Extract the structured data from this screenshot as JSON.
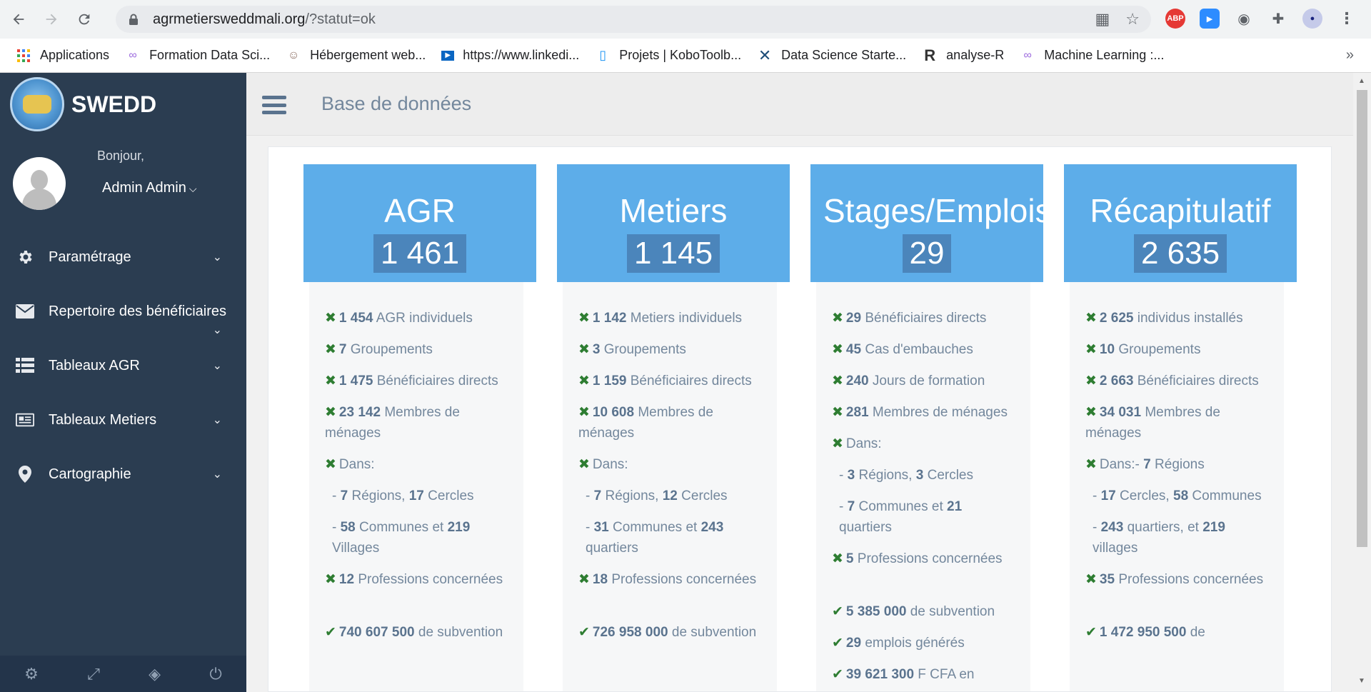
{
  "browser": {
    "url_host": "agrmetiersweddmali.org",
    "url_path": "/?statut=ok",
    "bookmarks": [
      {
        "label": "Applications",
        "icon": "apps-grid-icon"
      },
      {
        "label": "Formation Data Sci...",
        "icon": "infinity-icon"
      },
      {
        "label": "Hébergement web...",
        "icon": "mascot-icon"
      },
      {
        "label": "https://www.linkedi...",
        "icon": "video-icon"
      },
      {
        "label": "Projets | KoboToolb...",
        "icon": "kobo-icon"
      },
      {
        "label": "Data Science Starte...",
        "icon": "x-logo-icon"
      },
      {
        "label": "analyse-R",
        "icon": "r-logo-icon"
      },
      {
        "label": "Machine Learning :...",
        "icon": "infinity-icon"
      }
    ],
    "extensions": [
      "ABP"
    ]
  },
  "sidebar": {
    "brand": "SWEDD",
    "greeting": "Bonjour,",
    "user": "Admin Admin",
    "menu": [
      {
        "label": "Paramétrage",
        "icon": "gear-icon"
      },
      {
        "label": "Repertoire des bénéficiaires",
        "icon": "envelope-icon"
      },
      {
        "label": "Tableaux AGR",
        "icon": "table-icon"
      },
      {
        "label": "Tableaux Metiers",
        "icon": "newspaper-icon"
      },
      {
        "label": "Cartographie",
        "icon": "map-pin-icon"
      }
    ]
  },
  "header": {
    "title": "Base de données"
  },
  "cards": [
    {
      "title": "AGR",
      "count": "1 461",
      "lines": [
        {
          "num": "1 454",
          "text": " AGR individuels"
        },
        {
          "num": "7",
          "text": " Groupements"
        },
        {
          "num": "1 475",
          "text": " Bénéficiaires directs"
        },
        {
          "num": "23 142",
          "text": " Membres de ménages"
        },
        {
          "text": "Dans:"
        },
        {
          "pre": "- ",
          "num": "7",
          "text": " Régions, ",
          "num2": "17",
          "text2": " Cercles"
        },
        {
          "pre": "- ",
          "num": "58",
          "text": " Communes et ",
          "num2": "219",
          "text2": " Villages"
        },
        {
          "num": "12",
          "text": " Professions concernées"
        }
      ],
      "subvention": {
        "num": "740 607 500",
        "text": " de subvention"
      }
    },
    {
      "title": "Metiers",
      "count": "1 145",
      "lines": [
        {
          "num": "1 142",
          "text": " Metiers individuels"
        },
        {
          "num": "3",
          "text": " Groupements"
        },
        {
          "num": "1 159",
          "text": " Bénéficiaires directs"
        },
        {
          "num": "10 608",
          "text": " Membres de ménages"
        },
        {
          "text": "Dans:"
        },
        {
          "pre": "- ",
          "num": "7",
          "text": " Régions, ",
          "num2": "12",
          "text2": " Cercles"
        },
        {
          "pre": "- ",
          "num": "31",
          "text": " Communes et ",
          "num2": "243",
          "text2": " quartiers"
        },
        {
          "num": "18",
          "text": " Professions concernées"
        }
      ],
      "subvention": {
        "num": "726 958 000",
        "text": " de subvention"
      }
    },
    {
      "title": "Stages/Emplois",
      "count": "29",
      "lines": [
        {
          "num": "29",
          "text": " Bénéficiaires directs"
        },
        {
          "num": "45",
          "text": " Cas d'embauches"
        },
        {
          "num": "240",
          "text": " Jours de formation"
        },
        {
          "num": "281",
          "text": " Membres de ménages"
        },
        {
          "text": "Dans:"
        },
        {
          "pre": "- ",
          "num": "3",
          "text": " Régions, ",
          "num2": "3",
          "text2": " Cercles"
        },
        {
          "pre": "- ",
          "num": "7",
          "text": " Communes et ",
          "num2": "21",
          "text2": " quartiers"
        },
        {
          "num": "5",
          "text": " Professions concernées"
        }
      ],
      "extras": [
        {
          "num": "5 385 000",
          "text": " de subvention"
        },
        {
          "num": "29",
          "text": " emplois générés"
        },
        {
          "num": "39 621 300",
          "text": " F CFA en"
        }
      ]
    },
    {
      "title": "Récapitulatif",
      "count": "2 635",
      "lines": [
        {
          "num": "2 625",
          "text": " individus installés"
        },
        {
          "num": "10",
          "text": " Groupements"
        },
        {
          "num": "2 663",
          "text": " Bénéficiaires directs"
        },
        {
          "num": "34 031",
          "text": " Membres de ménages"
        },
        {
          "text": "Dans:- ",
          "num": "7",
          "text_after": " Régions"
        },
        {
          "pre": "- ",
          "num": "17",
          "text": " Cercles, ",
          "num2": "58",
          "text2": " Communes"
        },
        {
          "pre": "- ",
          "num": "243",
          "text": " quartiers, et ",
          "num2": "219",
          "text2": " villages"
        },
        {
          "num": "35",
          "text": " Professions concernées"
        }
      ],
      "subvention": {
        "num": "1 472 950 500",
        "text": " de"
      }
    }
  ]
}
